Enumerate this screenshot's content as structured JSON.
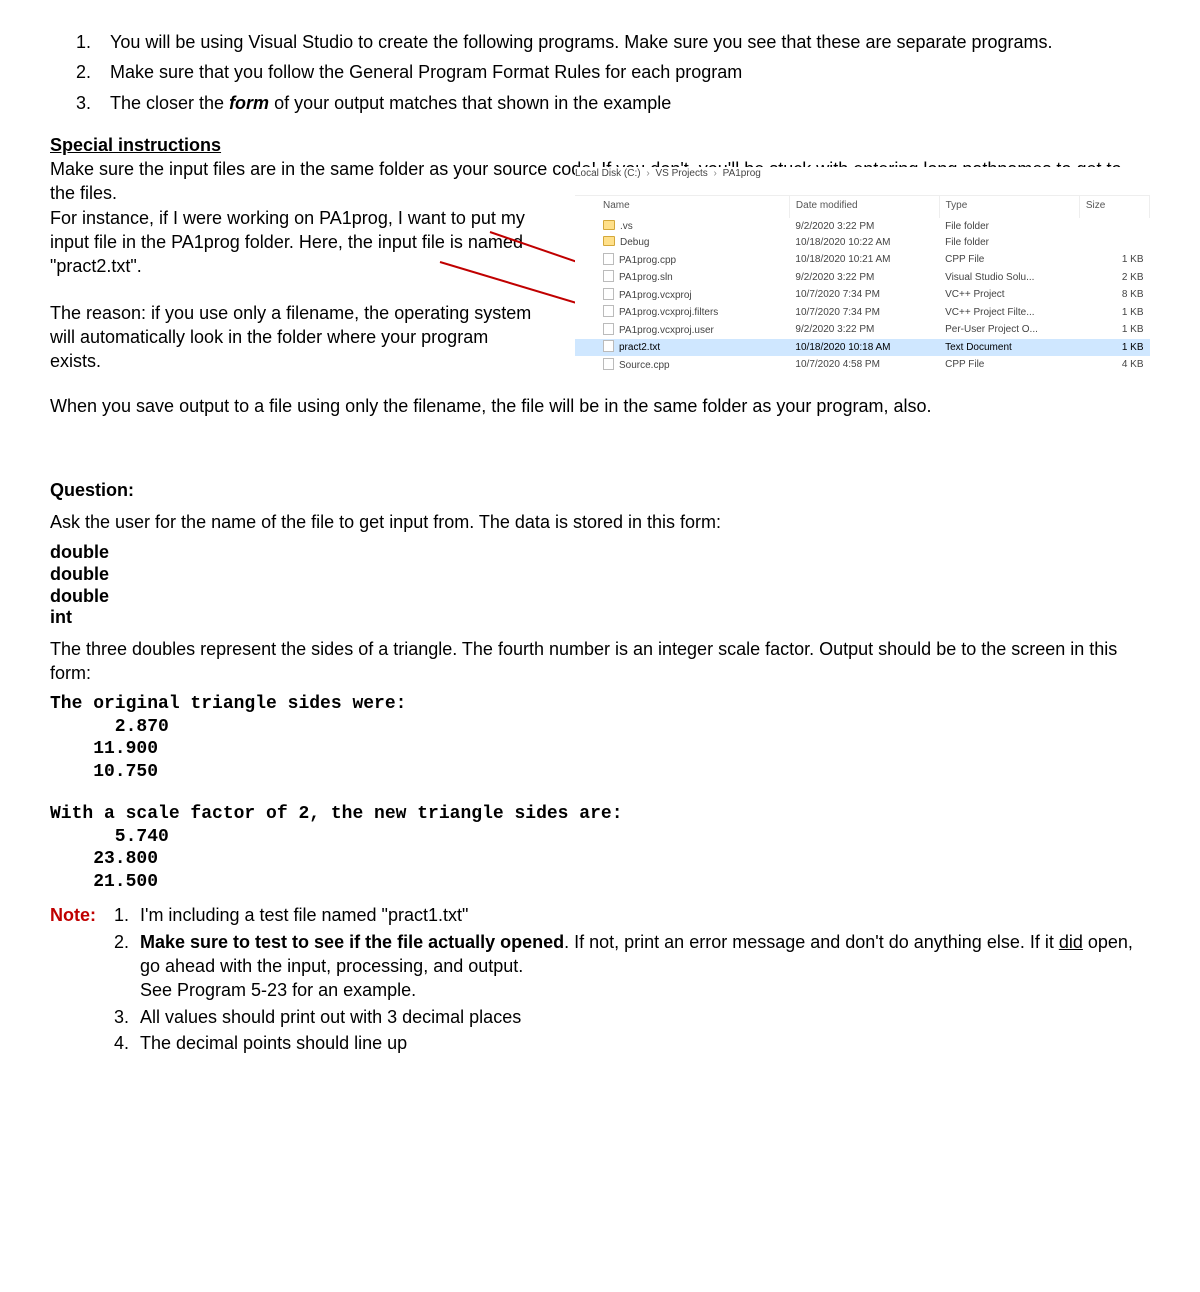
{
  "top_list": {
    "item1": "You will be using Visual Studio to create the following programs. Make sure you see that these are separate programs.",
    "item2": "Make sure that you follow the General Program Format Rules for each program",
    "item3_a": "The closer the ",
    "item3_b": "form",
    "item3_c": " of your output matches that shown in the example"
  },
  "special": {
    "heading": "Special instructions",
    "para1_a": "Make sure the input files are in the same folder as your source code! If you don't, you'll be stuck with entering long pathnames to get to the files.",
    "para1_b": "For instance, if I were working on PA1prog, I want to put my input file in the PA1prog folder. Here, the input file is named \"pract2.txt\".",
    "reason": "The reason: if you use only a filename, the operating system will automatically look in the folder where your program exists.",
    "save_para": "When you save output to a file using only the filename, the file will be in the same folder as your program, also."
  },
  "explorer": {
    "breadcrumb": [
      "Local Disk (C:)",
      "VS Projects",
      "PA1prog"
    ],
    "headers": {
      "name": "Name",
      "date": "Date modified",
      "type": "Type",
      "size": "Size"
    },
    "rows": [
      {
        "icon": "folder",
        "name": ".vs",
        "date": "9/2/2020 3:22 PM",
        "type": "File folder",
        "size": ""
      },
      {
        "icon": "folder",
        "name": "Debug",
        "date": "10/18/2020 10:22 AM",
        "type": "File folder",
        "size": ""
      },
      {
        "icon": "file",
        "name": "PA1prog.cpp",
        "date": "10/18/2020 10:21 AM",
        "type": "CPP File",
        "size": "1 KB"
      },
      {
        "icon": "file",
        "name": "PA1prog.sln",
        "date": "9/2/2020 3:22 PM",
        "type": "Visual Studio Solu...",
        "size": "2 KB"
      },
      {
        "icon": "file",
        "name": "PA1prog.vcxproj",
        "date": "10/7/2020 7:34 PM",
        "type": "VC++ Project",
        "size": "8 KB"
      },
      {
        "icon": "file",
        "name": "PA1prog.vcxproj.filters",
        "date": "10/7/2020 7:34 PM",
        "type": "VC++ Project Filte...",
        "size": "1 KB"
      },
      {
        "icon": "file",
        "name": "PA1prog.vcxproj.user",
        "date": "9/2/2020 3:22 PM",
        "type": "Per-User Project O...",
        "size": "1 KB"
      },
      {
        "icon": "file",
        "name": "pract2.txt",
        "date": "10/18/2020 10:18 AM",
        "type": "Text Document",
        "size": "1 KB",
        "selected": true
      },
      {
        "icon": "file",
        "name": "Source.cpp",
        "date": "10/7/2020 4:58 PM",
        "type": "CPP File",
        "size": "4 KB"
      }
    ]
  },
  "question": {
    "heading": "Question:",
    "ask": "Ask the user for the name of the file to get input from. The data is stored in this form:",
    "form": [
      "double",
      "double",
      "double",
      "int"
    ],
    "explain": "The three doubles represent the sides of a triangle. The fourth number is an integer scale factor. Output should be to the screen in this form:",
    "output1": "The original triangle sides were:\n      2.870\n    11.900\n    10.750",
    "output2": "With a scale factor of 2, the new triangle sides are:\n      5.740\n    23.800\n    21.500"
  },
  "note": {
    "label": "Note:",
    "item1": "I'm including a test file named \"pract1.txt\"",
    "item2_a": "Make sure to test to see if the file actually opened",
    "item2_b": ". If not, print an error message and don't do anything else. If it ",
    "item2_c": "did",
    "item2_d": " open, go ahead with the input, processing, and output.",
    "item2_e": "See Program 5-23 for an example.",
    "item3": "All values should print out with 3 decimal places",
    "item4": "The decimal points should line up"
  }
}
